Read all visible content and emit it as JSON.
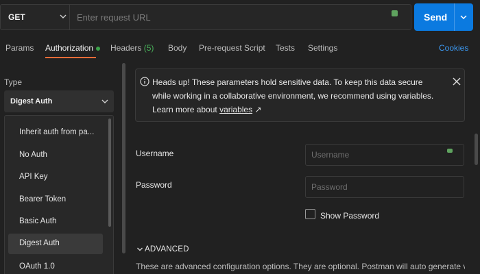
{
  "request": {
    "method": "GET",
    "url_placeholder": "Enter request URL",
    "send_label": "Send"
  },
  "tabs": [
    {
      "label": "Params"
    },
    {
      "label": "Authorization"
    },
    {
      "label": "Headers",
      "count": "(5)"
    },
    {
      "label": "Body"
    },
    {
      "label": "Pre-request Script"
    },
    {
      "label": "Tests"
    },
    {
      "label": "Settings"
    }
  ],
  "cookies_label": "Cookies",
  "auth": {
    "type_label": "Type",
    "selected": "Digest Auth",
    "options": [
      "Inherit auth from pa...",
      "No Auth",
      "API Key",
      "Bearer Token",
      "Basic Auth",
      "Digest Auth",
      "OAuth 1.0"
    ]
  },
  "banner": {
    "text": "Heads up! These parameters hold sensitive data. To keep this data secure while working in a collaborative environment, we recommend using variables. Learn more about ",
    "link": "variables",
    "link_arrow": "↗"
  },
  "form": {
    "username_label": "Username",
    "username_placeholder": "Username",
    "password_label": "Password",
    "password_placeholder": "Password",
    "show_password": "Show Password"
  },
  "advanced": {
    "label": "ADVANCED",
    "description": "These are advanced configuration options. They are optional. Postman will auto generate values"
  },
  "colors": {
    "accent": "#0b7ae0",
    "active_tab": "#ff6c37",
    "link": "#3d9bf5",
    "status_dot": "#3ca34a"
  }
}
